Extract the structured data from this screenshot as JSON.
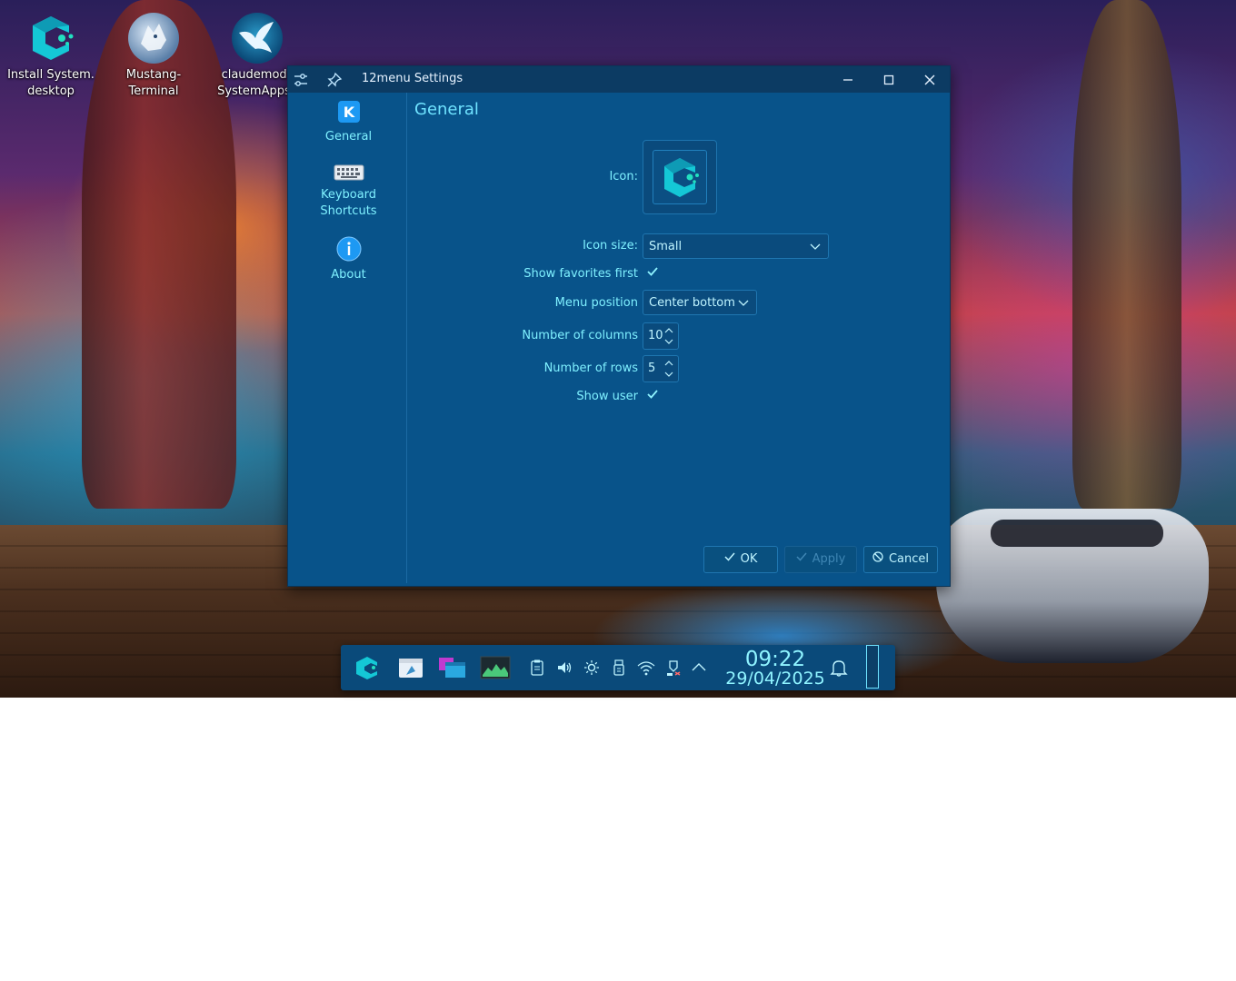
{
  "desktop": {
    "icons": [
      {
        "label_line1": "Install System.",
        "label_line2": "desktop",
        "icon": "app-logo-icon"
      },
      {
        "label_line1": "Mustang-",
        "label_line2": "Terminal",
        "icon": "wolf-icon"
      },
      {
        "label_line1": "claudemods",
        "label_line2": "SystemAppsc",
        "icon": "eagle-icon"
      }
    ]
  },
  "window": {
    "title": "12menu Settings",
    "titlebar_icons": [
      "settings-sliders-icon",
      "pin-icon"
    ],
    "controls": [
      "minimize-icon",
      "maximize-icon",
      "close-icon"
    ]
  },
  "sidebar": {
    "items": [
      {
        "label": "General",
        "icon": "kde-logo-icon"
      },
      {
        "label_line1": "Keyboard",
        "label_line2": "Shortcuts",
        "icon": "keyboard-icon"
      },
      {
        "label": "About",
        "icon": "info-icon"
      }
    ]
  },
  "general": {
    "page_title": "General",
    "icon_label": "Icon:",
    "icon_size_label": "Icon size:",
    "icon_size_value": "Small",
    "show_favorites_label": "Show favorites first",
    "show_favorites_checked": true,
    "menu_position_label": "Menu position",
    "menu_position_value": "Center bottom",
    "columns_label": "Number of columns",
    "columns_value": "10",
    "rows_label": "Number of rows",
    "rows_value": "5",
    "show_user_label": "Show user",
    "show_user_checked": true
  },
  "buttons": {
    "ok": "OK",
    "apply": "Apply",
    "cancel": "Cancel"
  },
  "taskbar": {
    "apps": [
      "app-launcher-icon",
      "file-manager-icon",
      "window-switcher-icon",
      "system-monitor-icon"
    ],
    "tray": [
      "clipboard-icon",
      "volume-icon",
      "brightness-icon",
      "usb-device-icon",
      "wifi-icon",
      "update-notifier-icon",
      "tray-expand-icon"
    ],
    "time": "09:22",
    "date": "29/04/2025"
  },
  "colors": {
    "window_bg": "#08538a",
    "accent_text": "#7ff0ff",
    "titlebar": "#0c3b63",
    "taskbar": "#0a4a7a"
  }
}
